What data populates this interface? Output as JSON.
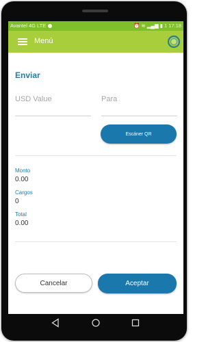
{
  "status_bar": {
    "carrier": "Avantel 4G LTE",
    "time": "17:18",
    "battery_text": "1"
  },
  "app_bar": {
    "menu_label": "Menú",
    "menu_icon": "hamburger-icon",
    "logo_icon": "brand-logo-icon"
  },
  "send": {
    "title": "Enviar",
    "usd_placeholder": "USD Value",
    "to_placeholder": "Para",
    "qr_button": "Escáner QR"
  },
  "summary": {
    "monto_label": "Monto",
    "monto_value": "0.00",
    "cargos_label": "Cargos",
    "cargos_value": "0",
    "total_label": "Total",
    "total_value": "0.00"
  },
  "actions": {
    "cancel": "Cancelar",
    "accept": "Aceptar"
  },
  "colors": {
    "status_bar": "#7fbf2a",
    "app_bar": "#a8cf3b",
    "primary": "#1a78ad",
    "accent_text": "#1f7fa5"
  }
}
